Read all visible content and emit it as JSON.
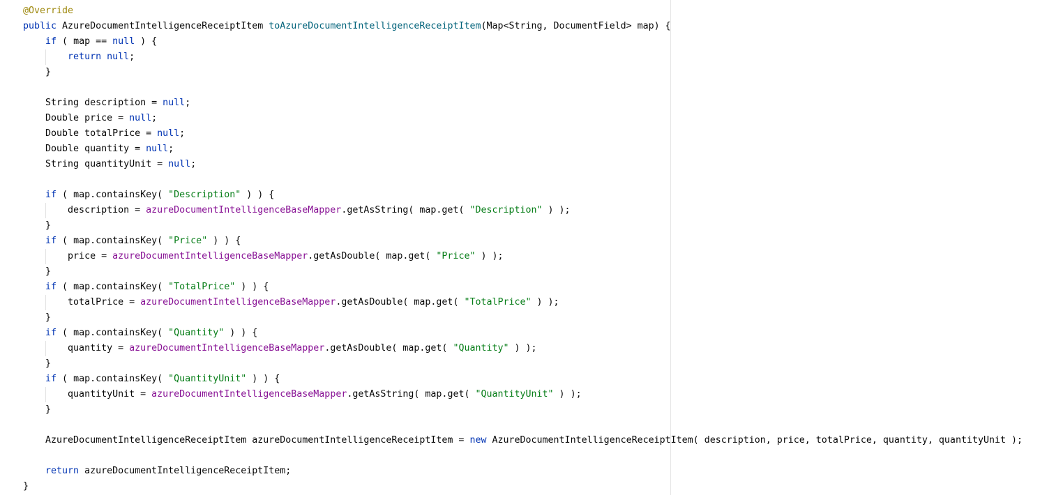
{
  "editor": {
    "language": "java",
    "colors": {
      "background": "#ffffff",
      "annotation": "#9e880d",
      "keyword": "#0033b3",
      "method_declaration": "#00627a",
      "string": "#067d17",
      "field": "#871094",
      "plain": "#080808",
      "margin_line": "#e6e6e6",
      "indent_guide": "#e3e3e3"
    },
    "lines": [
      {
        "indent": 0,
        "tokens": [
          {
            "t": "@Override",
            "k": "ann"
          }
        ]
      },
      {
        "indent": 0,
        "tokens": [
          {
            "t": "public",
            "k": "kw"
          },
          {
            "t": " AzureDocumentIntelligenceReceiptItem ",
            "k": "plain"
          },
          {
            "t": "toAzureDocumentIntelligenceReceiptItem",
            "k": "fn"
          },
          {
            "t": "(Map<String, DocumentField> map) {",
            "k": "plain"
          }
        ]
      },
      {
        "indent": 1,
        "tokens": [
          {
            "t": "if",
            "k": "kw"
          },
          {
            "t": " ( map == ",
            "k": "plain"
          },
          {
            "t": "null",
            "k": "kw"
          },
          {
            "t": " ) {",
            "k": "plain"
          }
        ]
      },
      {
        "indent": 2,
        "tokens": [
          {
            "t": "return",
            "k": "kw"
          },
          {
            "t": " ",
            "k": "plain"
          },
          {
            "t": "null",
            "k": "kw"
          },
          {
            "t": ";",
            "k": "plain"
          }
        ]
      },
      {
        "indent": 1,
        "tokens": [
          {
            "t": "}",
            "k": "plain"
          }
        ]
      },
      {
        "indent": 0,
        "tokens": []
      },
      {
        "indent": 1,
        "tokens": [
          {
            "t": "String description = ",
            "k": "plain"
          },
          {
            "t": "null",
            "k": "kw"
          },
          {
            "t": ";",
            "k": "plain"
          }
        ]
      },
      {
        "indent": 1,
        "tokens": [
          {
            "t": "Double price = ",
            "k": "plain"
          },
          {
            "t": "null",
            "k": "kw"
          },
          {
            "t": ";",
            "k": "plain"
          }
        ]
      },
      {
        "indent": 1,
        "tokens": [
          {
            "t": "Double totalPrice = ",
            "k": "plain"
          },
          {
            "t": "null",
            "k": "kw"
          },
          {
            "t": ";",
            "k": "plain"
          }
        ]
      },
      {
        "indent": 1,
        "tokens": [
          {
            "t": "Double quantity = ",
            "k": "plain"
          },
          {
            "t": "null",
            "k": "kw"
          },
          {
            "t": ";",
            "k": "plain"
          }
        ]
      },
      {
        "indent": 1,
        "tokens": [
          {
            "t": "String quantityUnit = ",
            "k": "plain"
          },
          {
            "t": "null",
            "k": "kw"
          },
          {
            "t": ";",
            "k": "plain"
          }
        ]
      },
      {
        "indent": 0,
        "tokens": []
      },
      {
        "indent": 1,
        "tokens": [
          {
            "t": "if",
            "k": "kw"
          },
          {
            "t": " ( map.containsKey( ",
            "k": "plain"
          },
          {
            "t": "\"Description\"",
            "k": "str"
          },
          {
            "t": " ) ) {",
            "k": "plain"
          }
        ]
      },
      {
        "indent": 2,
        "tokens": [
          {
            "t": "description = ",
            "k": "plain"
          },
          {
            "t": "azureDocumentIntelligenceBaseMapper",
            "k": "fld"
          },
          {
            "t": ".getAsString( map.get( ",
            "k": "plain"
          },
          {
            "t": "\"Description\"",
            "k": "str"
          },
          {
            "t": " ) );",
            "k": "plain"
          }
        ]
      },
      {
        "indent": 1,
        "tokens": [
          {
            "t": "}",
            "k": "plain"
          }
        ]
      },
      {
        "indent": 1,
        "tokens": [
          {
            "t": "if",
            "k": "kw"
          },
          {
            "t": " ( map.containsKey( ",
            "k": "plain"
          },
          {
            "t": "\"Price\"",
            "k": "str"
          },
          {
            "t": " ) ) {",
            "k": "plain"
          }
        ]
      },
      {
        "indent": 2,
        "tokens": [
          {
            "t": "price = ",
            "k": "plain"
          },
          {
            "t": "azureDocumentIntelligenceBaseMapper",
            "k": "fld"
          },
          {
            "t": ".getAsDouble( map.get( ",
            "k": "plain"
          },
          {
            "t": "\"Price\"",
            "k": "str"
          },
          {
            "t": " ) );",
            "k": "plain"
          }
        ]
      },
      {
        "indent": 1,
        "tokens": [
          {
            "t": "}",
            "k": "plain"
          }
        ]
      },
      {
        "indent": 1,
        "tokens": [
          {
            "t": "if",
            "k": "kw"
          },
          {
            "t": " ( map.containsKey( ",
            "k": "plain"
          },
          {
            "t": "\"TotalPrice\"",
            "k": "str"
          },
          {
            "t": " ) ) {",
            "k": "plain"
          }
        ]
      },
      {
        "indent": 2,
        "tokens": [
          {
            "t": "totalPrice = ",
            "k": "plain"
          },
          {
            "t": "azureDocumentIntelligenceBaseMapper",
            "k": "fld"
          },
          {
            "t": ".getAsDouble( map.get( ",
            "k": "plain"
          },
          {
            "t": "\"TotalPrice\"",
            "k": "str"
          },
          {
            "t": " ) );",
            "k": "plain"
          }
        ]
      },
      {
        "indent": 1,
        "tokens": [
          {
            "t": "}",
            "k": "plain"
          }
        ]
      },
      {
        "indent": 1,
        "tokens": [
          {
            "t": "if",
            "k": "kw"
          },
          {
            "t": " ( map.containsKey( ",
            "k": "plain"
          },
          {
            "t": "\"Quantity\"",
            "k": "str"
          },
          {
            "t": " ) ) {",
            "k": "plain"
          }
        ]
      },
      {
        "indent": 2,
        "tokens": [
          {
            "t": "quantity = ",
            "k": "plain"
          },
          {
            "t": "azureDocumentIntelligenceBaseMapper",
            "k": "fld"
          },
          {
            "t": ".getAsDouble( map.get( ",
            "k": "plain"
          },
          {
            "t": "\"Quantity\"",
            "k": "str"
          },
          {
            "t": " ) );",
            "k": "plain"
          }
        ]
      },
      {
        "indent": 1,
        "tokens": [
          {
            "t": "}",
            "k": "plain"
          }
        ]
      },
      {
        "indent": 1,
        "tokens": [
          {
            "t": "if",
            "k": "kw"
          },
          {
            "t": " ( map.containsKey( ",
            "k": "plain"
          },
          {
            "t": "\"QuantityUnit\"",
            "k": "str"
          },
          {
            "t": " ) ) {",
            "k": "plain"
          }
        ]
      },
      {
        "indent": 2,
        "tokens": [
          {
            "t": "quantityUnit = ",
            "k": "plain"
          },
          {
            "t": "azureDocumentIntelligenceBaseMapper",
            "k": "fld"
          },
          {
            "t": ".getAsString( map.get( ",
            "k": "plain"
          },
          {
            "t": "\"QuantityUnit\"",
            "k": "str"
          },
          {
            "t": " ) );",
            "k": "plain"
          }
        ]
      },
      {
        "indent": 1,
        "tokens": [
          {
            "t": "}",
            "k": "plain"
          }
        ]
      },
      {
        "indent": 0,
        "tokens": []
      },
      {
        "indent": 1,
        "tokens": [
          {
            "t": "AzureDocumentIntelligenceReceiptItem azureDocumentIntelligenceReceiptItem = ",
            "k": "plain"
          },
          {
            "t": "new",
            "k": "kw"
          },
          {
            "t": " AzureDocumentIntelligenceReceiptItem( description, price, totalPrice, quantity, quantityUnit );",
            "k": "plain"
          }
        ]
      },
      {
        "indent": 0,
        "tokens": []
      },
      {
        "indent": 1,
        "tokens": [
          {
            "t": "return",
            "k": "kw"
          },
          {
            "t": " azureDocumentIntelligenceReceiptItem;",
            "k": "plain"
          }
        ]
      },
      {
        "indent": 0,
        "tokens": [
          {
            "t": "}",
            "k": "plain"
          }
        ]
      }
    ]
  }
}
